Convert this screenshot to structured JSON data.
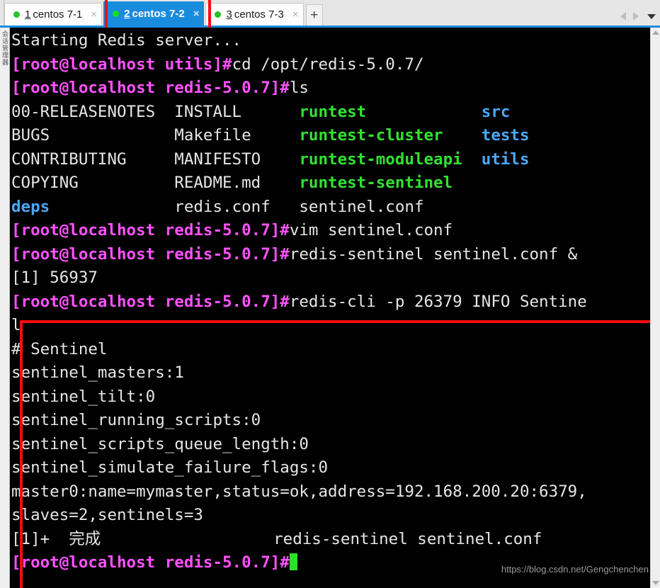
{
  "window": {
    "session_rail_label": "会话管理器"
  },
  "tabbar": {
    "tabs": [
      {
        "index": "1",
        "label": "centos 7-1",
        "status_dot": "green-dot-icon",
        "close": "×",
        "active": false
      },
      {
        "index": "2",
        "label": "centos 7-2",
        "status_dot": "green-dot-icon",
        "close": "×",
        "active": true
      },
      {
        "index": "3",
        "label": "centos 7-3",
        "status_dot": "green-dot-icon",
        "close": "×",
        "active": false
      }
    ],
    "new_tab_label": "+",
    "nav_prev_icon": "triangle-left-icon",
    "nav_next_icon": "triangle-right-icon",
    "nav_menu_icon": "chevron-down-icon"
  },
  "terminal": {
    "lines": [
      [
        {
          "t": "Starting Redis server...",
          "c": "white"
        }
      ],
      [
        {
          "t": "[root@localhost utils]#",
          "c": "magenta"
        },
        {
          "t": "cd /opt/redis-5.0.7/",
          "c": "white"
        }
      ],
      [
        {
          "t": "[root@localhost redis-5.0.7]#",
          "c": "magenta"
        },
        {
          "t": "ls",
          "c": "white"
        }
      ],
      [
        {
          "t": "00-RELEASENOTES  INSTALL      ",
          "c": "white"
        },
        {
          "t": "runtest            ",
          "c": "green"
        },
        {
          "t": "src",
          "c": "blue"
        }
      ],
      [
        {
          "t": "BUGS             Makefile     ",
          "c": "white"
        },
        {
          "t": "runtest-cluster    ",
          "c": "green"
        },
        {
          "t": "tests",
          "c": "blue"
        }
      ],
      [
        {
          "t": "CONTRIBUTING     MANIFESTO    ",
          "c": "white"
        },
        {
          "t": "runtest-moduleapi  ",
          "c": "green"
        },
        {
          "t": "utils",
          "c": "blue"
        }
      ],
      [
        {
          "t": "COPYING          README.md    ",
          "c": "white"
        },
        {
          "t": "runtest-sentinel",
          "c": "green"
        }
      ],
      [
        {
          "t": "deps",
          "c": "blue"
        },
        {
          "t": "             redis.conf   sentinel.conf",
          "c": "white"
        }
      ],
      [
        {
          "t": "[root@localhost redis-5.0.7]#",
          "c": "magenta"
        },
        {
          "t": "vim sentinel.conf",
          "c": "white"
        }
      ],
      [
        {
          "t": "[root@localhost redis-5.0.7]#",
          "c": "magenta"
        },
        {
          "t": "redis-sentinel sentinel.conf &",
          "c": "white"
        }
      ],
      [
        {
          "t": "[1] 56937",
          "c": "white"
        }
      ],
      [
        {
          "t": "[root@localhost redis-5.0.7]#",
          "c": "magenta"
        },
        {
          "t": "redis-cli -p 26379 INFO Sentine",
          "c": "white"
        }
      ],
      [
        {
          "t": "l",
          "c": "white"
        }
      ],
      [
        {
          "t": "# Sentinel",
          "c": "white"
        }
      ],
      [
        {
          "t": "sentinel_masters:1",
          "c": "white"
        }
      ],
      [
        {
          "t": "sentinel_tilt:0",
          "c": "white"
        }
      ],
      [
        {
          "t": "sentinel_running_scripts:0",
          "c": "white"
        }
      ],
      [
        {
          "t": "sentinel_scripts_queue_length:0",
          "c": "white"
        }
      ],
      [
        {
          "t": "sentinel_simulate_failure_flags:0",
          "c": "white"
        }
      ],
      [
        {
          "t": "master0:name=mymaster,status=ok,address=192.168.200.20:6379,",
          "c": "white"
        }
      ],
      [
        {
          "t": "slaves=2,sentinels=3",
          "c": "white"
        }
      ],
      [
        {
          "t": "[1]+  完成                  redis-sentinel sentinel.conf",
          "c": "white"
        }
      ],
      [
        {
          "t": "[root@localhost redis-5.0.7]#",
          "c": "magenta"
        },
        {
          "t": "",
          "c": "cursor"
        }
      ]
    ]
  },
  "watermark": {
    "text": "https://blog.csdn.net/Gengchenchen"
  },
  "annotations": {
    "tab_highlight": "red-box-active-tab",
    "output_highlight": "red-box-sentinel-output"
  },
  "colors": {
    "accent_blue": "#1a8cde",
    "annotation_red": "#fb0d0d",
    "term_background": "#000000",
    "prompt_magenta": "#ff52ff",
    "dir_green": "#33e033",
    "dir_blue": "#4aa8f7",
    "cursor_green": "#2ae02a"
  }
}
